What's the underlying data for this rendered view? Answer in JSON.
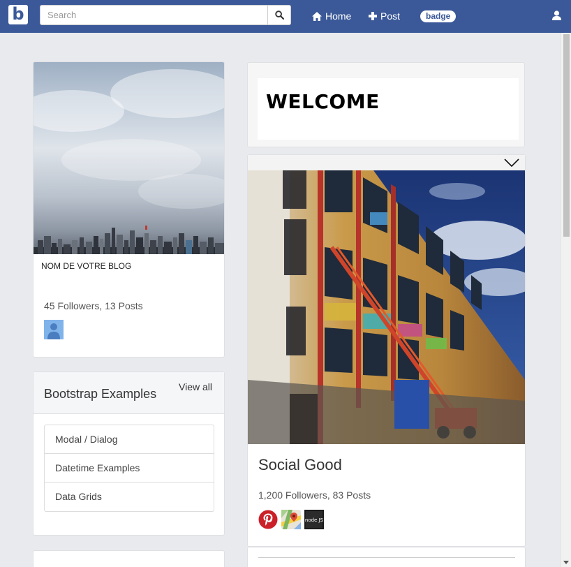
{
  "navbar": {
    "brand": "b",
    "search_placeholder": "Search",
    "home_label": "Home",
    "post_label": "Post",
    "badge_label": "badge",
    "brand_color": "#3b5998"
  },
  "profile": {
    "blog_name": "NOM DE VOTRE BLOG",
    "stats": "45 Followers, 13 Posts"
  },
  "examples": {
    "title": "Bootstrap Examples",
    "view_all": "View all",
    "items": [
      "Modal / Dialog",
      "Datetime Examples",
      "Data Grids"
    ]
  },
  "welcome": {
    "title": "WELCOME"
  },
  "social": {
    "title": "Social Good",
    "stats": "1,200 Followers, 83 Posts",
    "icons": [
      "pinterest-icon",
      "google-maps-icon",
      "nodejs-icon"
    ],
    "nodejs_label": "node JS"
  }
}
